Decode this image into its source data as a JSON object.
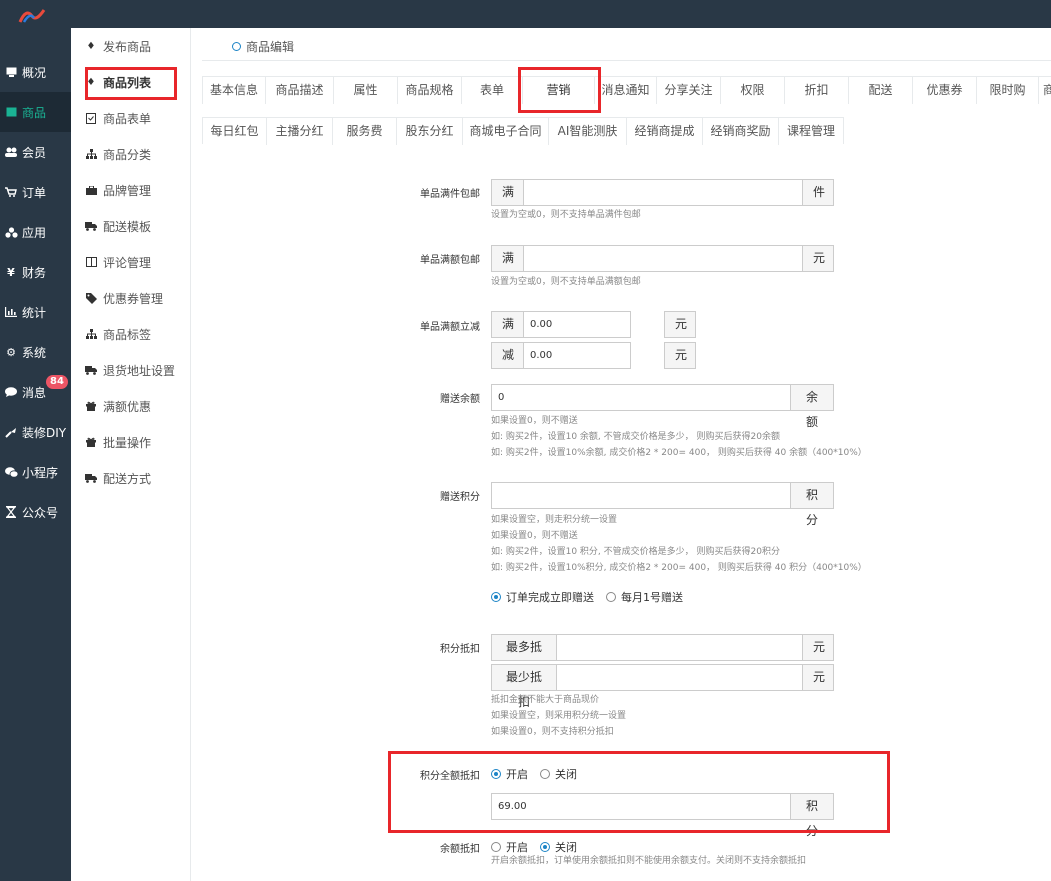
{
  "sidebar": {
    "items": [
      {
        "label": "概况",
        "icon": "monitor-icon"
      },
      {
        "label": "商品",
        "icon": "product-icon"
      },
      {
        "label": "会员",
        "icon": "users-icon"
      },
      {
        "label": "订单",
        "icon": "cart-icon"
      },
      {
        "label": "应用",
        "icon": "apps-icon"
      },
      {
        "label": "财务",
        "icon": "yen-icon"
      },
      {
        "label": "统计",
        "icon": "chart-icon"
      },
      {
        "label": "系统",
        "icon": "gear-icon"
      },
      {
        "label": "消息",
        "icon": "message-icon"
      },
      {
        "label": "装修DIY",
        "icon": "brush-icon"
      },
      {
        "label": "小程序",
        "icon": "wechat-icon"
      },
      {
        "label": "公众号",
        "icon": "hourglass-icon"
      }
    ],
    "message_badge": "84",
    "active_color": "#1ab394"
  },
  "subsidebar": {
    "items": [
      {
        "label": "发布商品",
        "icon": "cubes-icon"
      },
      {
        "label": "商品列表",
        "icon": "cubes-icon"
      },
      {
        "label": "商品表单",
        "icon": "file-icon"
      },
      {
        "label": "商品分类",
        "icon": "sitemap-icon"
      },
      {
        "label": "品牌管理",
        "icon": "briefcase-icon"
      },
      {
        "label": "配送模板",
        "icon": "truck-icon"
      },
      {
        "label": "评论管理",
        "icon": "columns-icon"
      },
      {
        "label": "优惠券管理",
        "icon": "tag-icon"
      },
      {
        "label": "商品标签",
        "icon": "sitemap-icon"
      },
      {
        "label": "退货地址设置",
        "icon": "truck-icon"
      },
      {
        "label": "满额优惠",
        "icon": "gift-icon"
      },
      {
        "label": "批量操作",
        "icon": "gift-icon"
      },
      {
        "label": "配送方式",
        "icon": "truck-icon"
      }
    ]
  },
  "breadcrumb": "商品编辑",
  "tabs_row1": [
    "基本信息",
    "商品描述",
    "属性",
    "商品规格",
    "表单",
    "营销",
    "消息通知",
    "分享关注",
    "权限",
    "折扣",
    "配送",
    "优惠券",
    "限时购",
    "商"
  ],
  "tabs_row2": [
    "每日红包",
    "主播分红",
    "服务费",
    "股东分红",
    "商城电子合同",
    "AI智能测肤",
    "经销商提成",
    "经销商奖励",
    "课程管理"
  ],
  "form": {
    "single_full_count": {
      "label": "单品满件包邮",
      "prefix": "满",
      "value": "",
      "suffix": "件",
      "hint": "设置为空或0，则不支持单品满件包邮"
    },
    "single_full_amount": {
      "label": "单品满额包邮",
      "prefix": "满",
      "value": "",
      "suffix": "元",
      "hint": "设置为空或0，则不支持单品满额包邮"
    },
    "single_full_reduce": {
      "label": "单品满额立减",
      "prefix1": "满",
      "value1": "0.00",
      "suffix1": "元",
      "prefix2": "减",
      "value2": "0.00",
      "suffix2": "元"
    },
    "gift_balance": {
      "label": "赠送余额",
      "value": "0",
      "suffix": "余额",
      "hints": [
        "如果设置0，则不赠送",
        "如: 购买2件，设置10 余额, 不管成交价格是多少， 则购买后获得20余额",
        "如: 购买2件，设置10%余额, 成交价格2 * 200= 400， 则购买后获得 40 余额（400*10%）"
      ]
    },
    "gift_points": {
      "label": "赠送积分",
      "value": "",
      "suffix": "积分",
      "hints": [
        "如果设置空，则走积分统一设置",
        "如果设置0，则不赠送",
        "如: 购买2件，设置10 积分, 不管成交价格是多少， 则购买后获得20积分",
        "如: 购买2件，设置10%积分, 成交价格2 * 200= 400， 则购买后获得 40 积分（400*10%）"
      ],
      "options": [
        "订单完成立即赠送",
        "每月1号赠送"
      ],
      "selected": 0
    },
    "points_deduct": {
      "label": "积分抵扣",
      "max_prefix": "最多抵扣",
      "max_value": "",
      "max_suffix": "元",
      "min_prefix": "最少抵扣",
      "min_value": "",
      "min_suffix": "元",
      "hints": [
        "抵扣金额不能大于商品现价",
        "如果设置空，则采用积分统一设置",
        "如果设置0，则不支持积分抵扣"
      ]
    },
    "points_full_deduct": {
      "label": "积分全额抵扣",
      "options": [
        "开启",
        "关闭"
      ],
      "selected": 0,
      "value": "69.00",
      "suffix": "积分"
    },
    "balance_deduct": {
      "label": "余额抵扣",
      "options": [
        "开启",
        "关闭"
      ],
      "selected": 1,
      "hint": "开启余额抵扣，订单使用余额抵扣则不能使用余额支付。关闭则不支持余额抵扣"
    }
  },
  "colors": {
    "highlight": "#e8262a",
    "radio": "#1c84c6",
    "sidebar_bg": "#293846"
  }
}
